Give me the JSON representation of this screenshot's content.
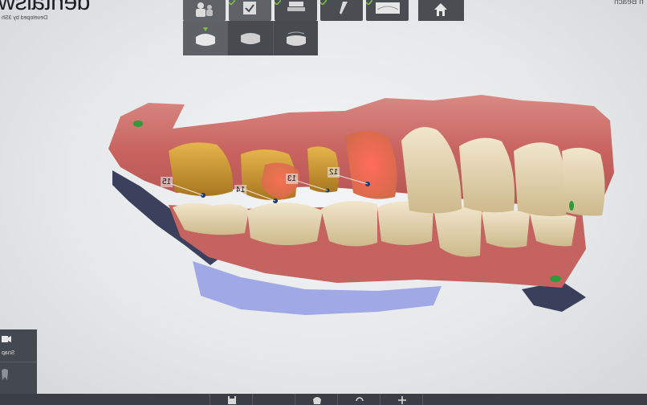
{
  "app": {
    "logo_text": "dentalsw",
    "logo_sub": "Developed by 3Sh",
    "top_right_text": "n Beach"
  },
  "toolbar": {
    "items": [
      {
        "name": "patient-icon",
        "active": true,
        "checked": false
      },
      {
        "name": "order-icon",
        "active": true,
        "checked": true
      },
      {
        "name": "scan-icon",
        "active": false,
        "checked": true
      },
      {
        "name": "tool-icon",
        "active": false,
        "checked": true
      },
      {
        "name": "model-icon",
        "active": false,
        "checked": true
      }
    ],
    "home_icon": "home-icon",
    "check_color": "#7bc142"
  },
  "subbar": {
    "items": [
      {
        "name": "upper-jaw-icon",
        "selected": true
      },
      {
        "name": "lower-jaw-icon",
        "selected": false
      },
      {
        "name": "bite-icon",
        "selected": false
      }
    ]
  },
  "side_panel": {
    "snapshot_label": "Snap",
    "snapshot_icon": "camera-icon",
    "other_icon": "tooth-icon"
  },
  "bottom_bar": {
    "items": [
      {
        "name": "save-icon"
      },
      {
        "name": "tooth-view-icon"
      },
      {
        "name": "rotate-icon"
      },
      {
        "name": "add-icon"
      }
    ]
  },
  "tooth_labels": [
    "15",
    "14",
    "13",
    "12"
  ],
  "colors": {
    "gum": "#c96a66",
    "tooth": "#e8d9b5",
    "prepared": "#d9a03a",
    "highlight": "#e9584e",
    "scan_blue": "#9ea7e6",
    "scan_dark": "#3a3f5c"
  }
}
